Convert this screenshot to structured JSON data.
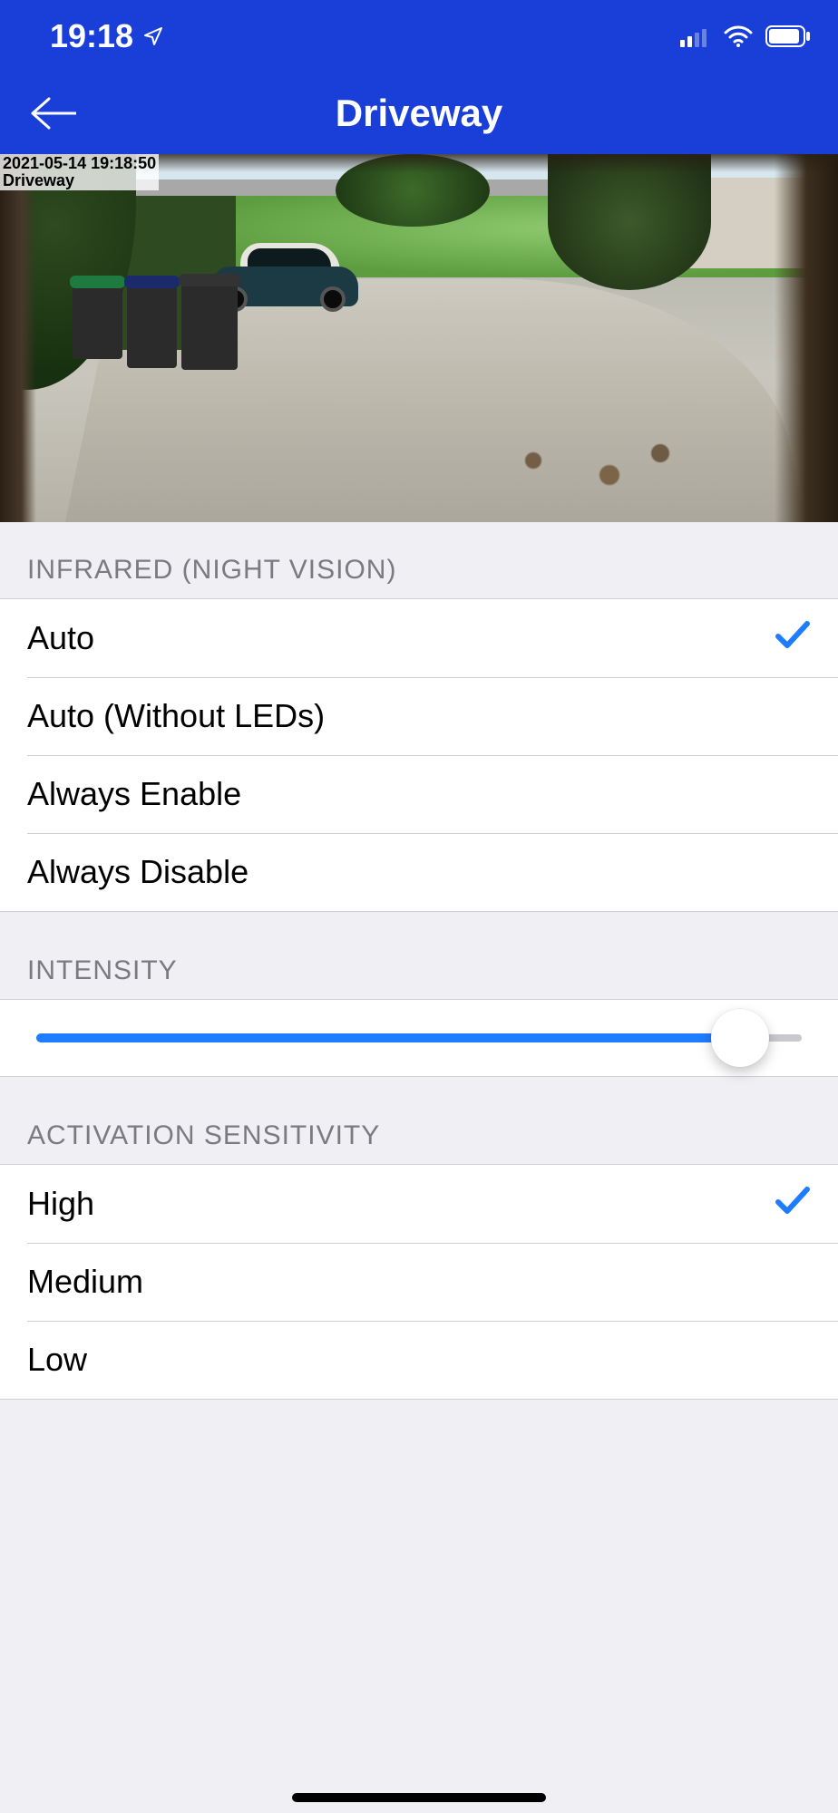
{
  "status_bar": {
    "time": "19:18",
    "location_icon": "location-arrow",
    "cellular_bars": 2,
    "wifi_icon": "wifi",
    "battery_icon": "battery"
  },
  "header": {
    "back_icon": "back-arrow",
    "title": "Driveway"
  },
  "camera_overlay": {
    "timestamp": "2021-05-14 19:18:50",
    "name": "Driveway"
  },
  "sections": {
    "infrared": {
      "title": "INFRARED (NIGHT VISION)",
      "options": {
        "auto": "Auto",
        "auto_no_leds": "Auto (Without LEDs)",
        "always_enable": "Always Enable",
        "always_disable": "Always Disable"
      },
      "selected": "auto"
    },
    "intensity": {
      "title": "INTENSITY",
      "value_percent": 92
    },
    "sensitivity": {
      "title": "ACTIVATION SENSITIVITY",
      "options": {
        "high": "High",
        "medium": "Medium",
        "low": "Low"
      },
      "selected": "high"
    }
  }
}
